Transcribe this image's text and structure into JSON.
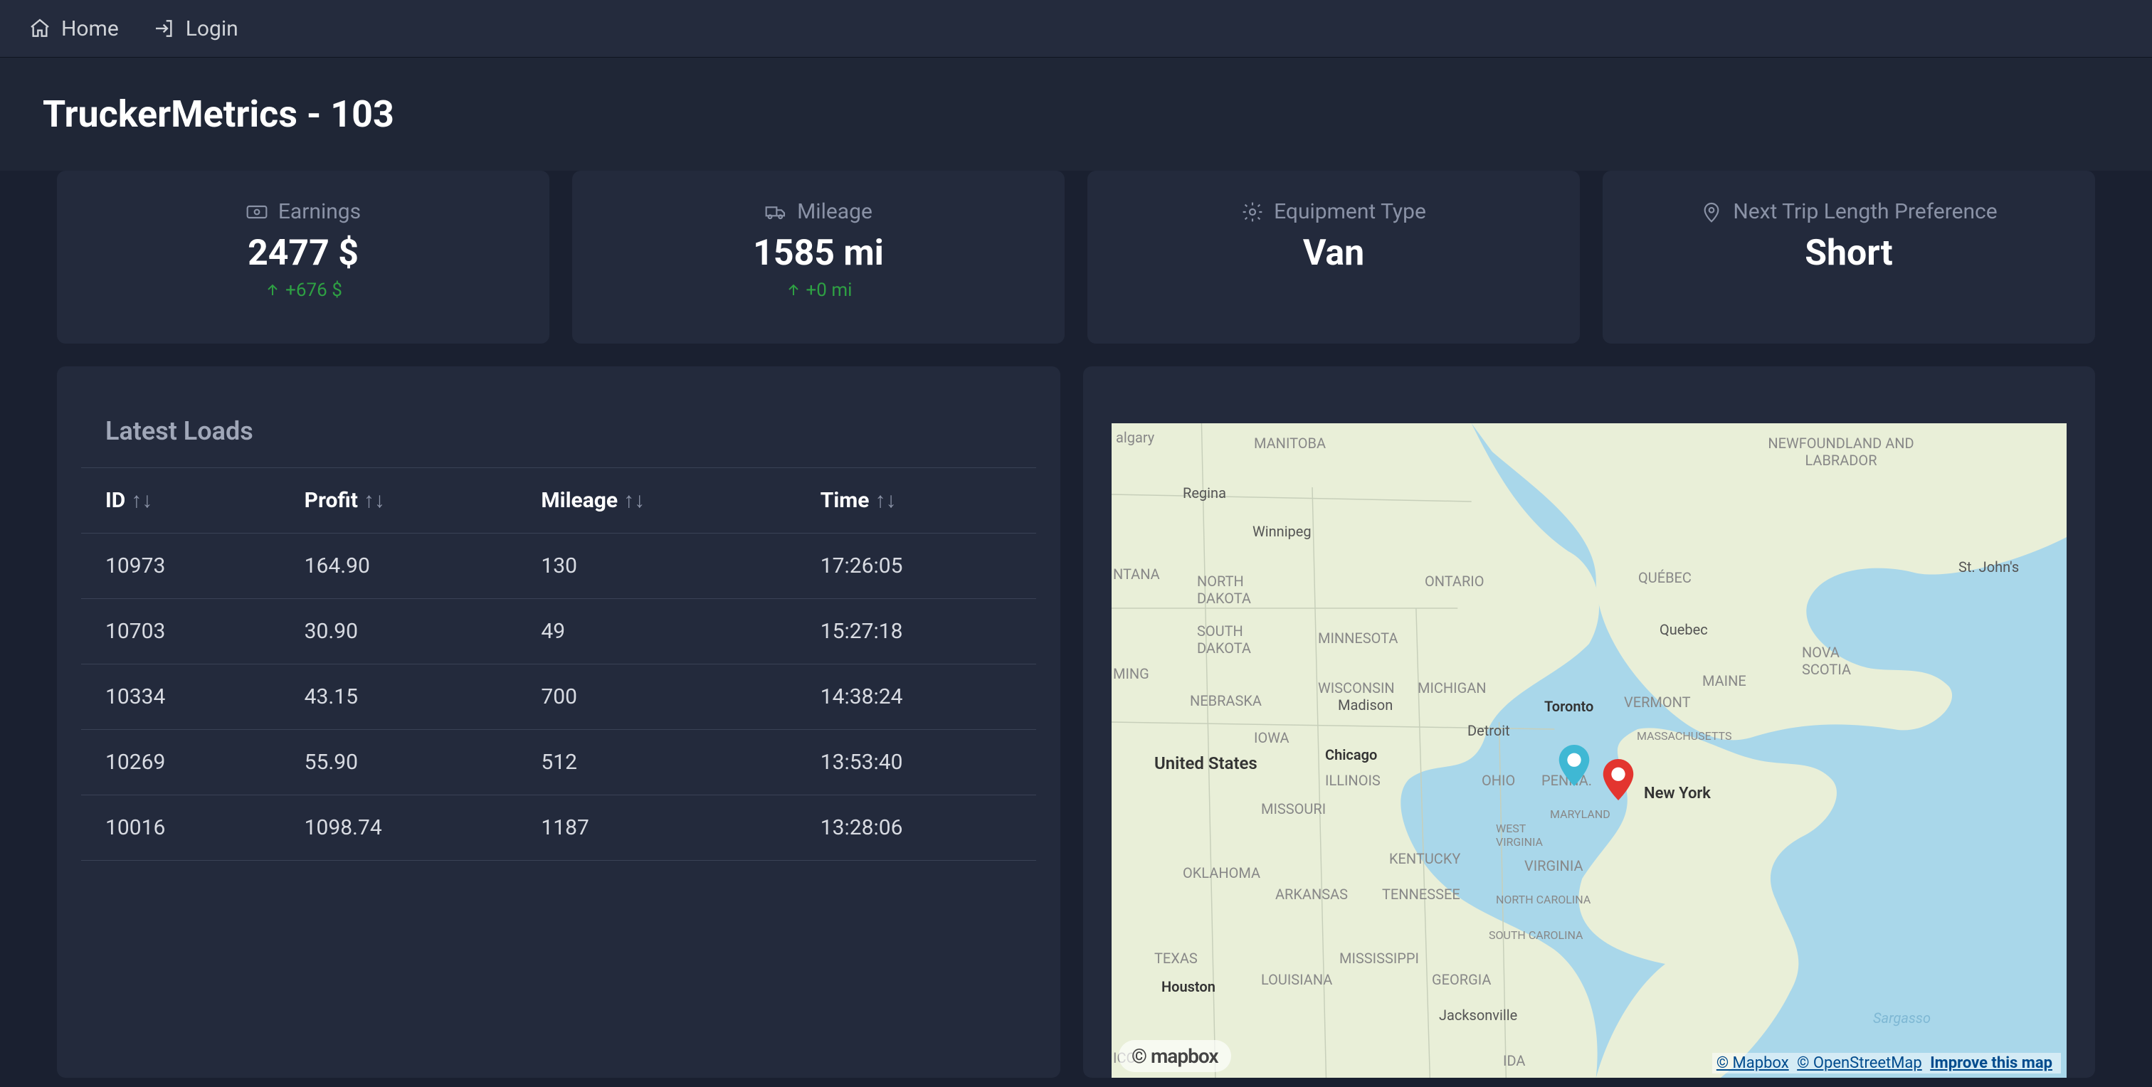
{
  "nav": {
    "home": "Home",
    "login": "Login"
  },
  "header": {
    "title": "TruckerMetrics - 103"
  },
  "cards": {
    "earnings": {
      "label": "Earnings",
      "value": "2477 $",
      "delta": "+676 $"
    },
    "mileage": {
      "label": "Mileage",
      "value": "1585 mi",
      "delta": "+0 mi"
    },
    "equipment": {
      "label": "Equipment Type",
      "value": "Van"
    },
    "tripPref": {
      "label": "Next Trip Length Preference",
      "value": "Short"
    }
  },
  "loads": {
    "title": "Latest Loads",
    "columns": {
      "id": "ID",
      "profit": "Profit",
      "mileage": "Mileage",
      "time": "Time"
    },
    "rows": [
      {
        "id": "10973",
        "profit": "164.90",
        "mileage": "130",
        "time": "17:26:05"
      },
      {
        "id": "10703",
        "profit": "30.90",
        "mileage": "49",
        "time": "15:27:18"
      },
      {
        "id": "10334",
        "profit": "43.15",
        "mileage": "700",
        "time": "14:38:24"
      },
      {
        "id": "10269",
        "profit": "55.90",
        "mileage": "512",
        "time": "13:53:40"
      },
      {
        "id": "10016",
        "profit": "1098.74",
        "mileage": "1187",
        "time": "13:28:06"
      }
    ]
  },
  "map": {
    "logo": "mapbox",
    "attrib": {
      "mapbox": "© Mapbox",
      "osm": "© OpenStreetMap",
      "improve": "Improve this map"
    },
    "places": {
      "manitoba": "MANITOBA",
      "newfoundland": "NEWFOUNDLAND AND LABRADOR",
      "regina": "Regina",
      "winnipeg": "Winnipeg",
      "montana": "NTANA",
      "ndakota": "NORTH DAKOTA",
      "sdakota": "SOUTH DAKOTA",
      "ontario": "ONTARIO",
      "quebecProv": "QUÉBEC",
      "stjohns": "St. John's",
      "minnesota": "MINNESOTA",
      "ming": "MING",
      "nebraska": "NEBRASKA",
      "wisconsin": "WISCONSIN",
      "madison": "Madison",
      "michigan": "MICHIGAN",
      "quebecCity": "Quebec",
      "novascotia": "NOVA SCOTIA",
      "maine": "MAINE",
      "vermont": "VERMONT",
      "iowa": "IOWA",
      "toronto": "Toronto",
      "detroit": "Detroit",
      "massachusetts": "MASSACHUSETTS",
      "unitedstates": "United States",
      "chicago": "Chicago",
      "illinois": "ILLINOIS",
      "ohio": "OHIO",
      "penna": "PENNA.",
      "newyork": "New York",
      "maryland": "MARYLAND",
      "missouri": "MISSOURI",
      "westvirginia": "WEST VIRGINIA",
      "virginia": "VIRGINIA",
      "oklahoma": "OKLAHOMA",
      "arkansas": "ARKANSAS",
      "kentucky": "KENTUCKY",
      "tennessee": "TENNESSEE",
      "ncarolina": "NORTH CAROLINA",
      "scarolina": "SOUTH CAROLINA",
      "texas": "TEXAS",
      "houston": "Houston",
      "louisiana": "LOUISIANA",
      "mississippi": "MISSISSIPPI",
      "georgia": "GEORGIA",
      "jacksonville": "Jacksonville",
      "ida": "IDA",
      "ico": "ICO",
      "sargasso": "Sargasso",
      "algary": "algary"
    }
  }
}
